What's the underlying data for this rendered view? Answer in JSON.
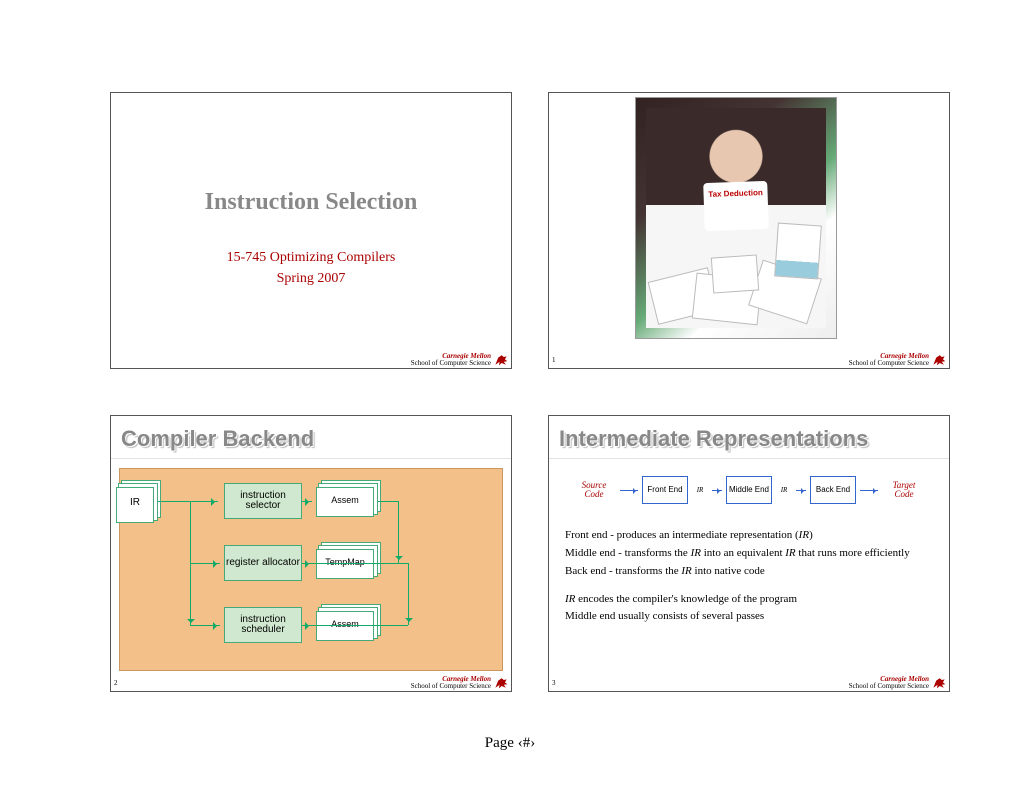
{
  "pageLabel": "Page ‹#›",
  "footer": {
    "cmu": "Carnegie Mellon",
    "scs": "School of Computer Science"
  },
  "slide1": {
    "num": "",
    "title": "Instruction Selection",
    "sub1": "15-745 Optimizing Compilers",
    "sub2": "Spring 2007"
  },
  "slide2": {
    "num": "1",
    "bib": "Tax Deduction"
  },
  "slide3": {
    "num": "2",
    "title": "Compiler Backend",
    "ir": "IR",
    "stage1": "instruction selector",
    "out1": "Assem",
    "stage2": "register allocator",
    "out2": "TempMap",
    "stage3": "instruction scheduler",
    "out3": "Assem"
  },
  "slide4": {
    "num": "3",
    "title": "Intermediate Representations",
    "src": "Source Code",
    "tgt": "Target Code",
    "b1": "Front End",
    "b2": "Middle End",
    "b3": "Back End",
    "ir": "IR",
    "p1a": "Front end - produces an intermediate representation (",
    "p1b": ")",
    "p2a": "Middle end - transforms the ",
    "p2b": " into an equivalent ",
    "p2c": " that runs more efficiently",
    "p3a": "Back end - transforms the ",
    "p3b": " into native code",
    "p4a": "",
    "p4b": " encodes the compiler's knowledge of the program",
    "p5": "Middle end usually consists of several passes",
    "IR": "IR"
  }
}
